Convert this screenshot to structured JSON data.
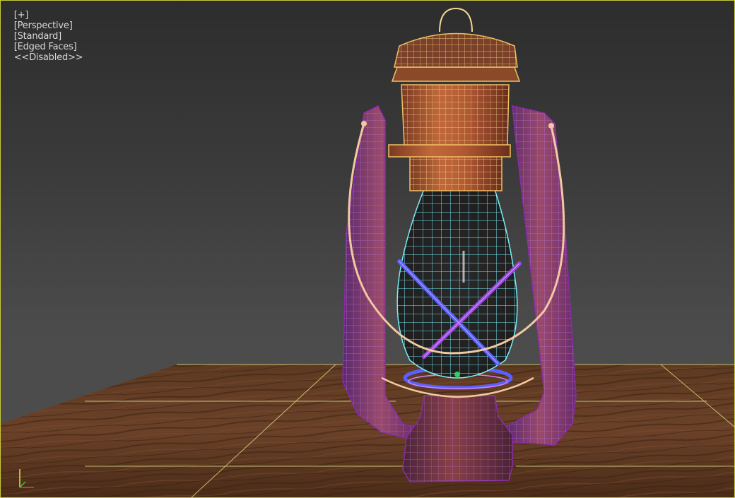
{
  "viewport": {
    "menu_plus": "[+]",
    "view_type": "[Perspective]",
    "shading_mode": "[Standard]",
    "display_mode": "[Edged Faces]",
    "disabled_label": "<<Disabled>>"
  },
  "colors": {
    "background_top": "#2d2d2d",
    "background_bottom": "#4e4e4e",
    "viewport_border": "#c9c93a",
    "grid_lines": "#d4d46a",
    "wood_floor": "#5a3520",
    "copper": "#a8522e",
    "frame_purple": "#7a3a8a",
    "wire_orange": "#f0c060",
    "wire_cyan": "#6ee6f0",
    "wire_blue": "#6070ff",
    "handle_peach": "#f2c9a0"
  },
  "icons": {
    "axis_gizmo": "xyz-axis-tripod-icon"
  }
}
